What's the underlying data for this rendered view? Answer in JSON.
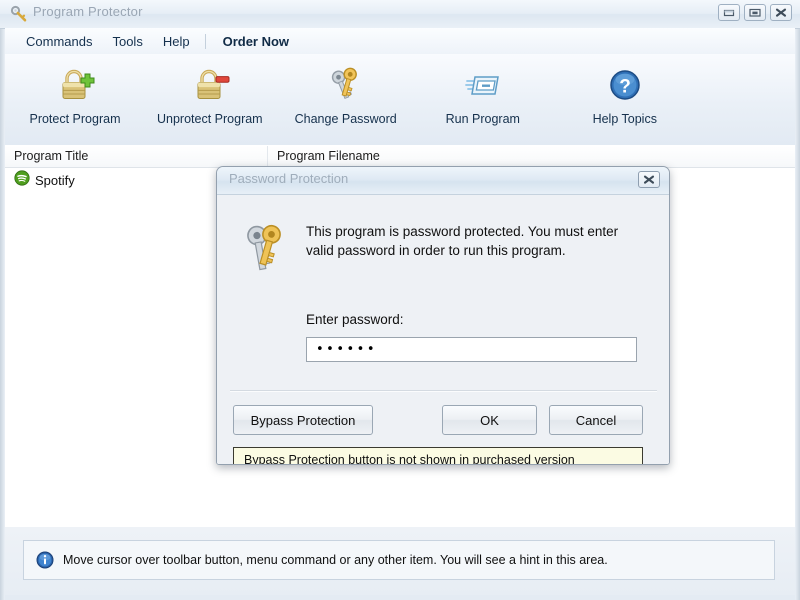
{
  "window": {
    "title": "Program Protector",
    "icon": "key-icon",
    "controls": [
      {
        "name": "minimize-button",
        "glyph": "minimize-icon"
      },
      {
        "name": "maximize-button",
        "glyph": "maximize-icon"
      },
      {
        "name": "close-button",
        "glyph": "close-icon"
      }
    ]
  },
  "menubar": {
    "items": [
      {
        "label": "Commands"
      },
      {
        "label": "Tools"
      },
      {
        "label": "Help"
      },
      {
        "label": "Order Now"
      }
    ]
  },
  "toolbar": {
    "buttons": [
      {
        "label": "Protect Program",
        "icon": "lock-plus-icon"
      },
      {
        "label": "Unprotect Program",
        "icon": "lock-minus-icon"
      },
      {
        "label": "Change Password",
        "icon": "keys-icon"
      },
      {
        "label": "Run Program",
        "icon": "run-window-icon"
      },
      {
        "label": "Help Topics",
        "icon": "help-question-icon"
      }
    ]
  },
  "list": {
    "columns": [
      {
        "label": "Program Title"
      },
      {
        "label": "Program Filename"
      }
    ],
    "rows": [
      {
        "title": "Spotify",
        "icon": "spotify-icon",
        "filename": ""
      }
    ]
  },
  "hint": {
    "icon": "info-icon",
    "text": "Move cursor over toolbar button, menu command or any other item. You will see a hint in this area."
  },
  "dialog": {
    "title": "Password Protection",
    "close_label": "close-icon",
    "icon": "keys-icon",
    "message": "This program is password protected. You must enter valid password in order to run this program.",
    "password_label": "Enter password:",
    "password_value": "••••••",
    "password_placeholder": "",
    "buttons": {
      "bypass": "Bypass Protection",
      "ok": "OK",
      "cancel": "Cancel"
    },
    "notice": "Bypass Protection button is not shown in purchased version"
  },
  "colors": {
    "accent_blue": "#2e6fb7",
    "notice_bg": "#fbfbe3",
    "spotify_green": "#4a9e1f",
    "window_bg": "#eef2f7"
  }
}
